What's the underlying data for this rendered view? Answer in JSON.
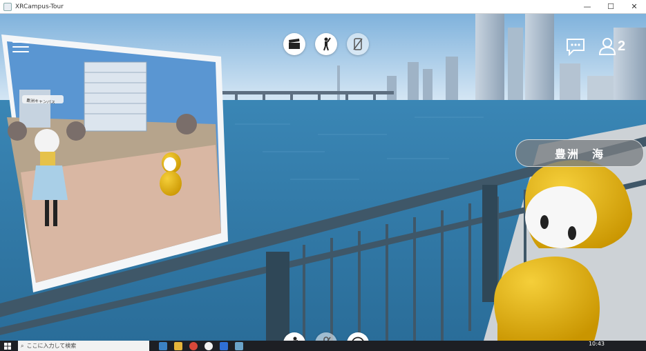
{
  "window": {
    "title": "XRCampus-Tour",
    "minimize": "—",
    "maximize": "☐",
    "close": "✕"
  },
  "top_toolbar": [
    {
      "icon": "clapperboard-icon"
    },
    {
      "icon": "person-pointing-icon"
    },
    {
      "icon": "no-phone-icon"
    }
  ],
  "chat": {
    "icon": "chat-bubble-icon"
  },
  "users": {
    "icon": "user-icon",
    "count": "2"
  },
  "location_label": "豊洲　海",
  "preview_panel": {
    "sign_text": "豊洲キャンパス"
  },
  "bottom_toolbar": [
    {
      "icon": "dance-icon"
    },
    {
      "icon": "mic-muted-icon"
    },
    {
      "icon": "smiley-icon"
    }
  ],
  "taskbar": {
    "search_placeholder": "ここに入力して検索",
    "clock_time": "10:43"
  },
  "colors": {
    "avatar_yellow": "#e6b418",
    "water": "#2f7fae",
    "sky": "#cfe4f4"
  }
}
